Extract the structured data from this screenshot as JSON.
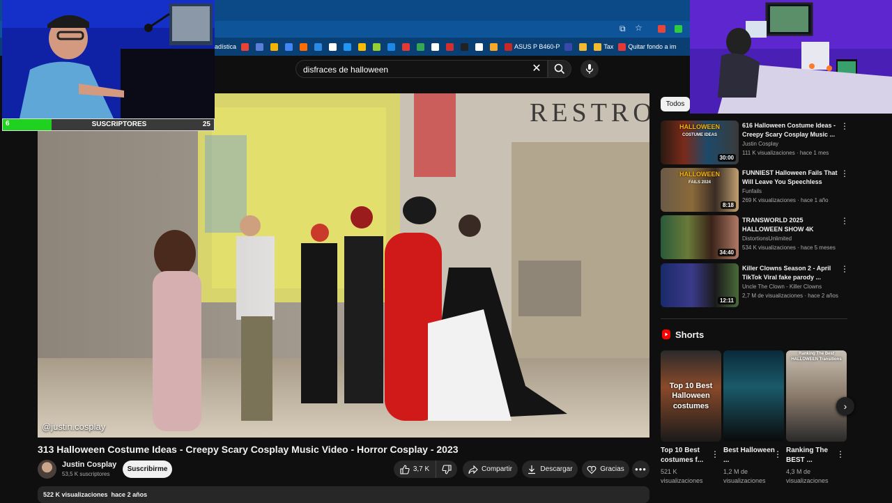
{
  "browser": {
    "bookmarks": [
      {
        "label": "adística",
        "color": "#1a73e8"
      },
      {
        "label": "",
        "color": "#ea4335"
      },
      {
        "label": "",
        "color": "#5b7fd8"
      },
      {
        "label": "",
        "color": "#f4b400"
      },
      {
        "label": "",
        "color": "#4285f4"
      },
      {
        "label": "",
        "color": "#ff6d00"
      },
      {
        "label": "",
        "color": "#2b8ae2"
      },
      {
        "label": "",
        "color": "#ffffff"
      },
      {
        "label": "",
        "color": "#2196f3"
      },
      {
        "label": "",
        "color": "#fbbc04"
      },
      {
        "label": "",
        "color": "#9acd32"
      },
      {
        "label": "",
        "color": "#1e88e5"
      },
      {
        "label": "",
        "color": "#e53935"
      },
      {
        "label": "",
        "color": "#34a853"
      },
      {
        "label": "",
        "color": "#ffffff"
      },
      {
        "label": "",
        "color": "#d32f2f"
      },
      {
        "label": "",
        "color": "#222222"
      },
      {
        "label": "",
        "color": "#ffffff"
      },
      {
        "label": "",
        "color": "#f9a825"
      },
      {
        "label": "ASUS P B460-P",
        "color": "#c62828"
      },
      {
        "label": "",
        "color": "#3949ab"
      },
      {
        "label": "",
        "color": "#f3ba2f"
      },
      {
        "label": "Tax",
        "color": "#f3ba2f"
      },
      {
        "label": "Quitar fondo a im",
        "color": "#e53935"
      }
    ]
  },
  "search": {
    "query": "disfraces de halloween"
  },
  "video": {
    "watermark": "@justin.cosplay",
    "title": "313 Halloween Costume Ideas - Creepy Scary Cosplay Music Video - Horror Cosplay - 2023",
    "channel": "Justin Cosplay",
    "subscribers": "53,5 K suscriptores",
    "subscribe_label": "Suscribirme",
    "likes": "3,7 K",
    "share_label": "Compartir",
    "download_label": "Descargar",
    "thanks_label": "Gracias",
    "description_meta": "522 K visualizaciones  hace 2 años"
  },
  "sidebar": {
    "chip": "Todos",
    "recommendations": [
      {
        "title": "616 Halloween Costume Ideas - Creepy Scary Cosplay Music ...",
        "channel": "Justin Cosplay",
        "meta": "111 K visualizaciones · hace 1 mes",
        "duration": "30:00",
        "thumb_text": "HALLOWEEN",
        "thumb_sub": "COSTUME IDEAS"
      },
      {
        "title": "FUNNIEST Halloween Fails That Will Leave You Speechless",
        "channel": "Funfails",
        "meta": "269 K visualizaciones · hace 1 año",
        "duration": "8:18",
        "thumb_text": "HALLOWEEN",
        "thumb_sub": "FAILS 2024"
      },
      {
        "title": "TRANSWORLD 2025 HALLOWEEN SHOW 4K",
        "channel": "DistortionsUnlimited",
        "meta": "534 K visualizaciones · hace 5 meses",
        "duration": "34:40",
        "thumb_text": "",
        "thumb_sub": ""
      },
      {
        "title": "Killer Clowns Season 2 - April TikTok Viral fake parody ...",
        "channel": "Uncle The Clown - Killer Clowns",
        "meta": "2,7 M de visualizaciones · hace 2 años",
        "duration": "12:11",
        "thumb_text": "",
        "thumb_sub": ""
      }
    ],
    "shorts_heading": "Shorts",
    "shorts": [
      {
        "title": "Top 10 Best costumes f...",
        "views": "521 K visualizaciones",
        "overlay": "Top 10 Best Halloween costumes"
      },
      {
        "title": "Best Halloween ...",
        "views": "1,2 M de visualizaciones",
        "overlay": ""
      },
      {
        "title": "Ranking The BEST ...",
        "views": "4,3 M de visualizaciones",
        "overlay": "Ranking The Best HALLOWEEN Transitions"
      }
    ]
  },
  "stream_overlay": {
    "sub_count": "6",
    "sub_label": "SUSCRIPTORES",
    "sub_goal": "25",
    "progress_fraction": 0.24
  },
  "colors": {
    "accent_red": "#ff0000",
    "progress_green": "#1fd21f",
    "bg": "#0f0f0f"
  }
}
